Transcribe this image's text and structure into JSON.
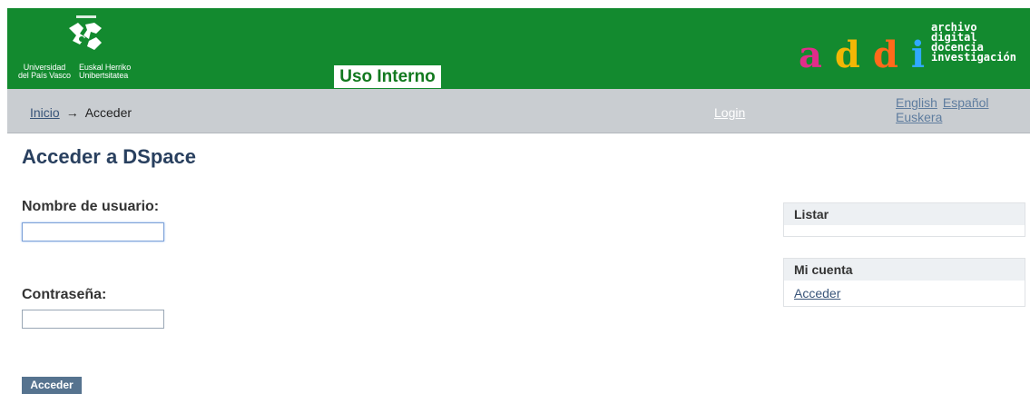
{
  "header": {
    "university_left": [
      "Universidad",
      "del País Vasco"
    ],
    "university_right": [
      "Euskal Herriko",
      "Unibertsitatea"
    ],
    "uso_interno": "Uso Interno",
    "brand_letters": [
      {
        "char": "a",
        "color": "#e12d8a"
      },
      {
        "char": "d",
        "color": "#f2b705"
      },
      {
        "char": "d",
        "color": "#ff6a1a"
      },
      {
        "char": "i",
        "color": "#30a9ff"
      }
    ],
    "brand_sub": [
      "archivo",
      "digital",
      "docencia",
      "investigación"
    ]
  },
  "nav": {
    "breadcrumb_home": "Inicio",
    "breadcrumb_arrow": "→",
    "breadcrumb_current": "Acceder",
    "login": "Login",
    "languages": {
      "english": "English",
      "espanol": "Español",
      "euskera": "Euskera"
    }
  },
  "main": {
    "title": "Acceder a DSpace",
    "username_label": "Nombre de usuario:",
    "username_value": "",
    "password_label": "Contraseña:",
    "password_value": "",
    "submit_label": "Acceder"
  },
  "sidebar": {
    "listar_heading": "Listar",
    "mi_cuenta_heading": "Mi cuenta",
    "acceder_link": "Acceder"
  },
  "colors": {
    "header_green": "#138a2f",
    "nav_gray": "#c9cdd1",
    "title_blue": "#29405f",
    "button_blue": "#56738f"
  }
}
